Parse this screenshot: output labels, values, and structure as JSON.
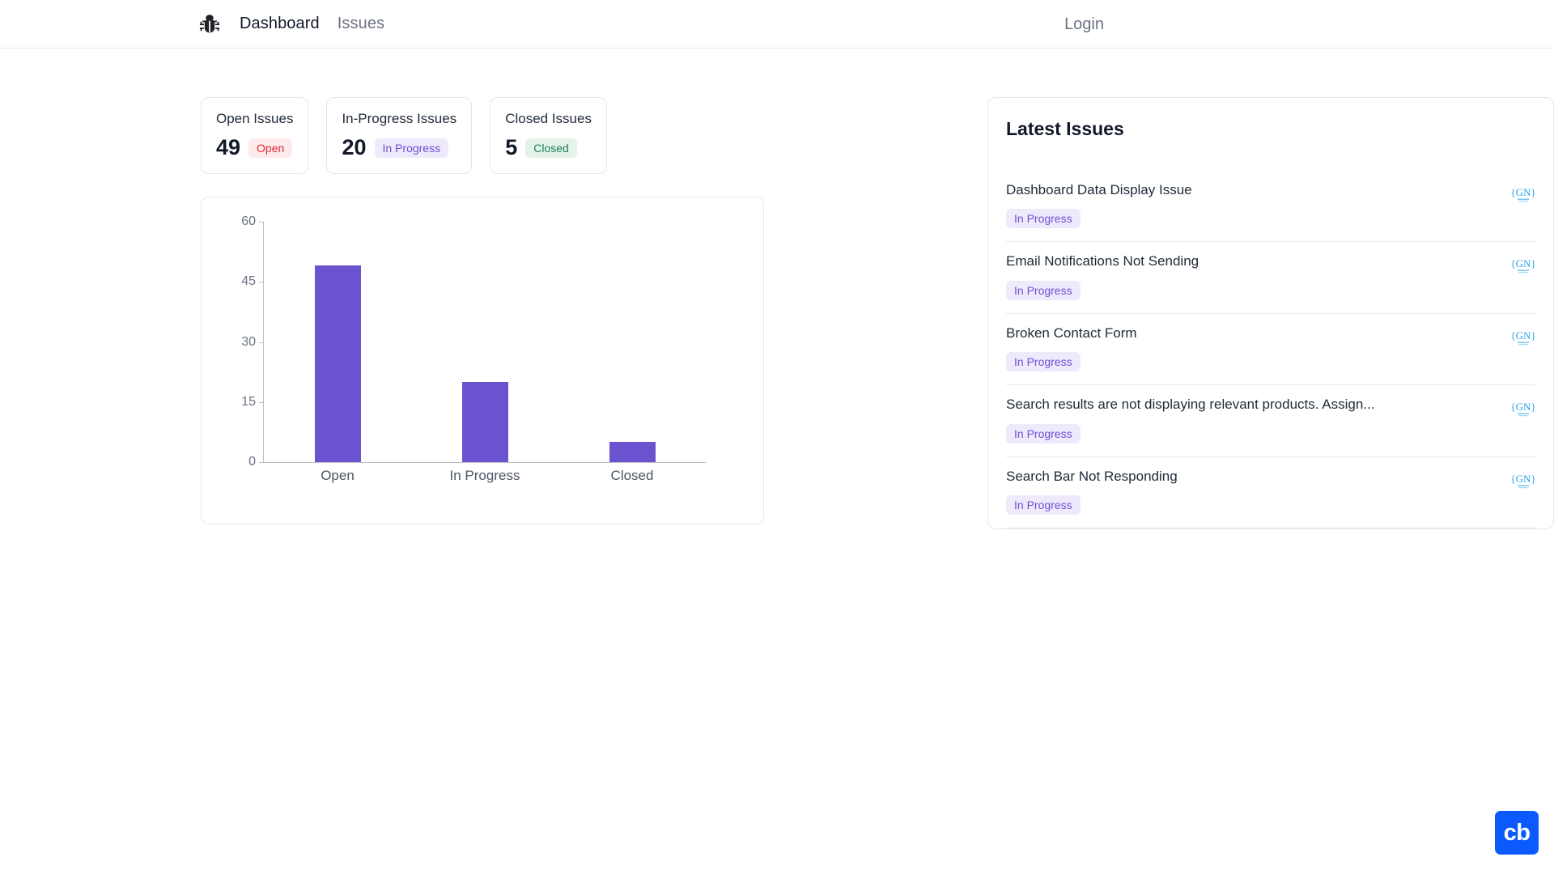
{
  "navbar": {
    "logo_icon": "bug-icon",
    "links": [
      {
        "label": "Dashboard",
        "active": true
      },
      {
        "label": "Issues",
        "active": false
      }
    ],
    "login_label": "Login"
  },
  "stats": [
    {
      "title": "Open Issues",
      "value": "49",
      "badge": "Open",
      "badge_kind": "open"
    },
    {
      "title": "In-Progress Issues",
      "value": "20",
      "badge": "In Progress",
      "badge_kind": "progress"
    },
    {
      "title": "Closed Issues",
      "value": "5",
      "badge": "Closed",
      "badge_kind": "closed"
    }
  ],
  "chart_data": {
    "type": "bar",
    "title": "",
    "xlabel": "",
    "ylabel": "",
    "categories": [
      "Open",
      "In Progress",
      "Closed"
    ],
    "values": [
      49,
      20,
      5
    ],
    "yticks": [
      0,
      15,
      30,
      45,
      60
    ],
    "ylim": [
      0,
      60
    ],
    "grid": false,
    "legend": "none",
    "bar_color": "#6b53d0"
  },
  "latest_issues": {
    "title": "Latest Issues",
    "rows": [
      {
        "title": "Dashboard Data Display Issue",
        "status": "In Progress",
        "avatar": "{GN}"
      },
      {
        "title": "Email Notifications Not Sending",
        "status": "In Progress",
        "avatar": "{GN}"
      },
      {
        "title": "Broken Contact Form",
        "status": "In Progress",
        "avatar": "{GN}"
      },
      {
        "title": "Search results are not displaying relevant products. Assign...",
        "status": "In Progress",
        "avatar": "{GN}"
      },
      {
        "title": "Search Bar Not Responding",
        "status": "In Progress",
        "avatar": "{GN}"
      }
    ]
  },
  "cb_widget": {
    "label": "cb",
    "color": "#0a5afe"
  }
}
